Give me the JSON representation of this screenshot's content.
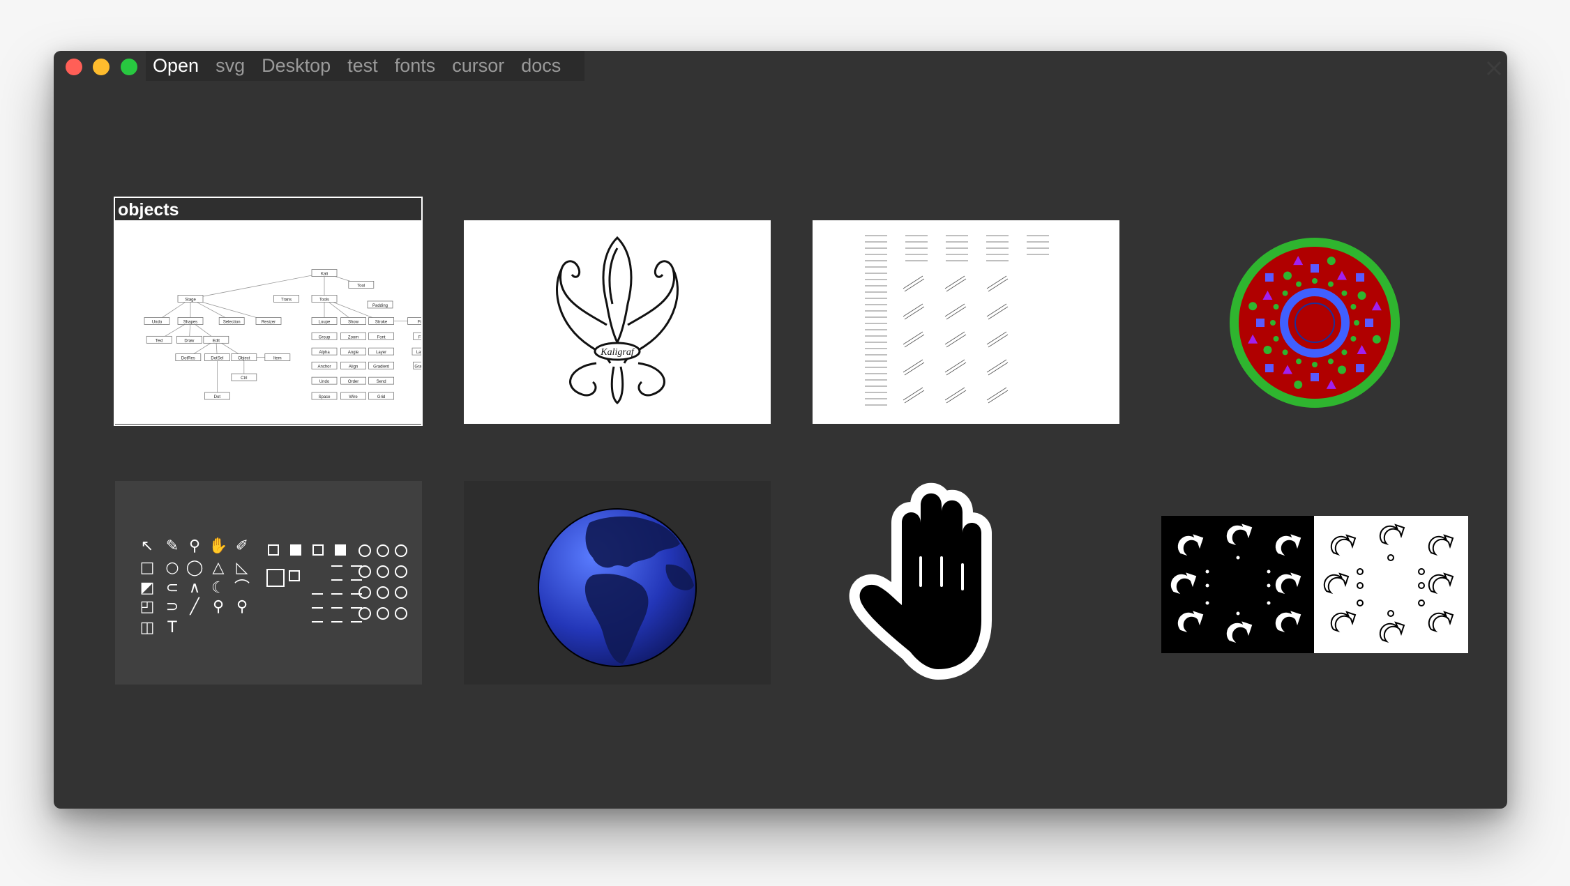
{
  "window": {
    "traffic_lights": {
      "close_color": "#ff5f57",
      "minimize_color": "#febc2e",
      "maximize_color": "#28c840"
    },
    "tabs": [
      {
        "label": "Open",
        "active": true
      },
      {
        "label": "svg",
        "active": false
      },
      {
        "label": "Desktop",
        "active": false
      },
      {
        "label": "test",
        "active": false
      },
      {
        "label": "fonts",
        "active": false
      },
      {
        "label": "cursor",
        "active": false
      },
      {
        "label": "docs",
        "active": false
      }
    ],
    "close_icon": "close-icon"
  },
  "grid": {
    "selected_caption": "objects",
    "items": [
      {
        "icon": "diagram-thumbnail"
      },
      {
        "icon": "fleur-de-lis-thumbnail",
        "label": "Kaligraf"
      },
      {
        "icon": "font-sample-thumbnail"
      },
      {
        "icon": "mandala-thumbnail"
      },
      {
        "icon": "tool-icons-thumbnail"
      },
      {
        "icon": "globe-thumbnail"
      },
      {
        "icon": "hand-cursor-thumbnail"
      },
      {
        "icon": "rotate-cursors-thumbnail"
      }
    ]
  },
  "diagram": {
    "nodes": [
      "Kali",
      "Tool",
      "Stage",
      "Trans",
      "Tools",
      "Padding",
      "Undo",
      "Shapes",
      "Selection",
      "Resizer",
      "Loupe",
      "Show",
      "Stroke",
      "Fill",
      "Text",
      "Draw",
      "Edit",
      "Group",
      "Zoom",
      "Font",
      "FontList",
      "DotRes",
      "DotSel",
      "Object",
      "Item",
      "Alpha",
      "Angle",
      "Layer",
      "LayerList",
      "Ctrl",
      "Anchor",
      "Align",
      "Gradient",
      "GradientList",
      "Dot",
      "Undo",
      "Order",
      "Send",
      "Space",
      "Wire",
      "Grid"
    ]
  },
  "colors": {
    "window_bg": "#333333",
    "tabbar_bg": "#2b2b2b",
    "text_active": "#ffffff",
    "text_inactive": "#9a9a9a"
  }
}
